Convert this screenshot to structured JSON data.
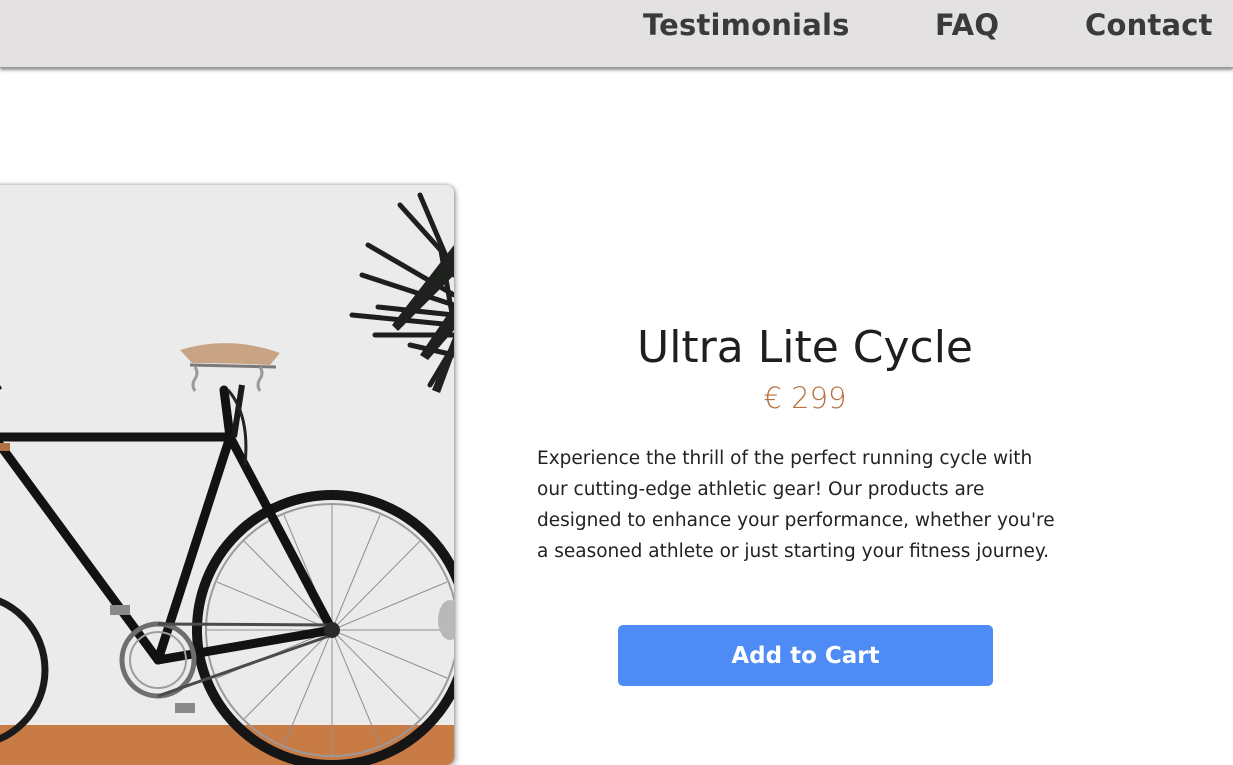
{
  "nav": {
    "items": [
      {
        "label": "Testimonials"
      },
      {
        "label": "FAQ"
      },
      {
        "label": "Contact"
      }
    ]
  },
  "product": {
    "title": "Ultra Lite Cycle",
    "price": "€ 299",
    "description": "Experience the thrill of the perfect running cycle with our cutting-edge athletic gear! Our products are designed to enhance your performance, whether you're a seasoned athlete or just starting your fitness journey.",
    "add_to_cart_label": "Add to Cart",
    "image_subject": "bicycle-photo"
  },
  "colors": {
    "navbar_bg": "#e3e1e2",
    "price": "#b7703c",
    "button": "#4e8bf5",
    "text": "#1f1f21"
  }
}
